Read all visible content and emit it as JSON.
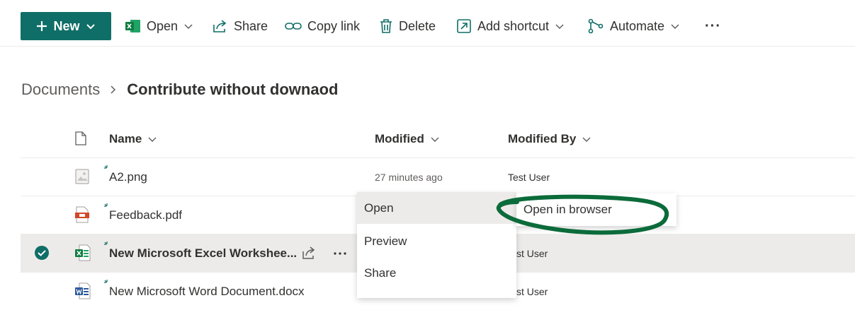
{
  "toolbar": {
    "new_label": "New",
    "open_label": "Open",
    "share_label": "Share",
    "copy_link_label": "Copy link",
    "delete_label": "Delete",
    "add_shortcut_label": "Add shortcut",
    "automate_label": "Automate",
    "more_label": "···"
  },
  "breadcrumb": {
    "root": "Documents",
    "current": "Contribute without downaod"
  },
  "columns": {
    "name": "Name",
    "modified": "Modified",
    "modified_by": "Modified By"
  },
  "files": [
    {
      "name": "A2.png",
      "modified": "27 minutes ago",
      "modified_by": "Test User",
      "icon": "image-file-icon"
    },
    {
      "name": "Feedback.pdf",
      "modified": "",
      "modified_by": "",
      "icon": "pdf-file-icon"
    },
    {
      "name": "New Microsoft Excel Workshee...",
      "modified": "",
      "modified_by": "st User",
      "icon": "excel-file-icon",
      "selected": true
    },
    {
      "name": "New Microsoft Word Document.docx",
      "modified": "",
      "modified_by": "st User",
      "icon": "word-file-icon"
    }
  ],
  "context_menu": {
    "items": [
      "Open",
      "Preview",
      "Share"
    ],
    "submenu_item": "Open in browser"
  },
  "colors": {
    "accent": "#0f6e67",
    "selected_row": "#edebe9",
    "annotation": "#0b6b3a",
    "excel": "#1d6f42",
    "word": "#2b579a",
    "pdf": "#d24726"
  }
}
